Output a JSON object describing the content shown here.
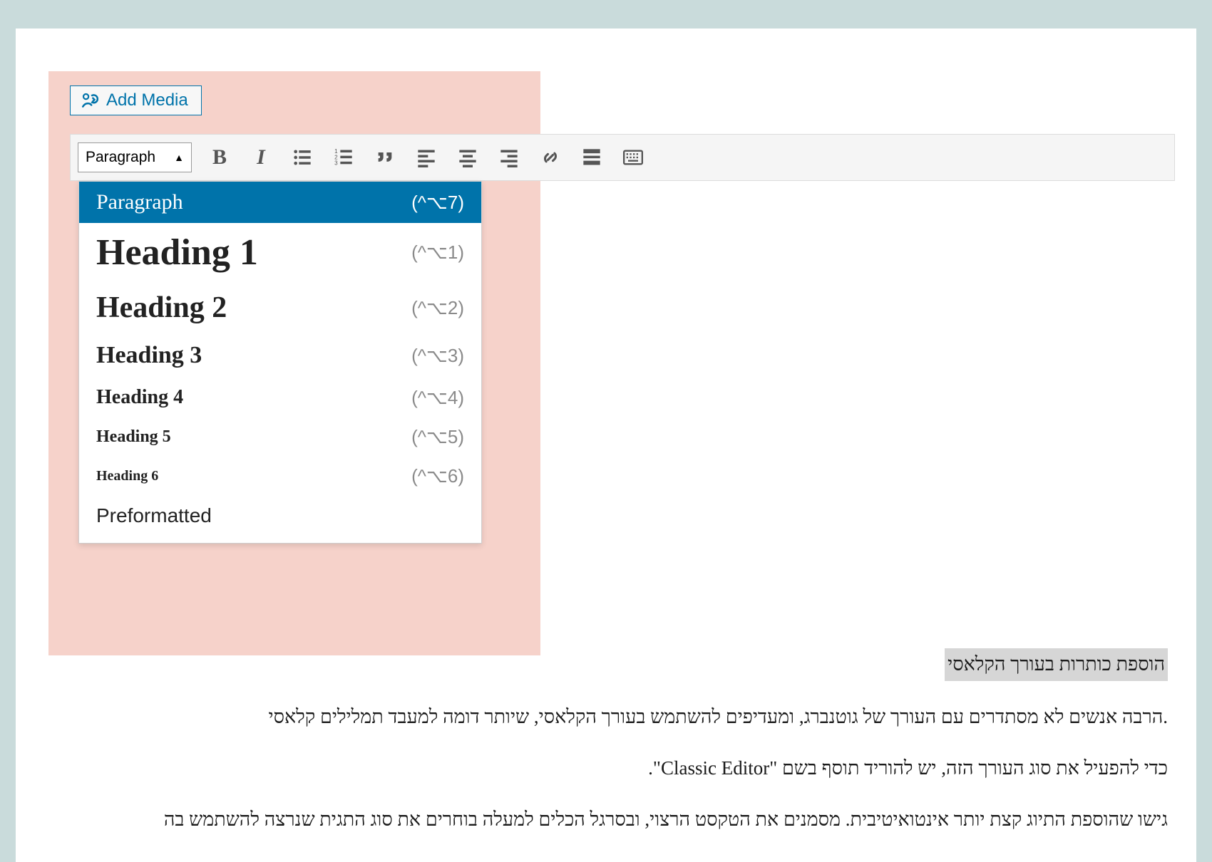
{
  "add_media_label": "Add Media",
  "toolbar": {
    "format_selected": "Paragraph",
    "bold_glyph": "B",
    "italic_glyph": "I"
  },
  "dropdown": {
    "items": [
      {
        "label": "Paragraph",
        "shortcut": "(^⌥7)",
        "cls": "selected"
      },
      {
        "label": "Heading 1",
        "shortcut": "(^⌥1)",
        "cls": "h1"
      },
      {
        "label": "Heading 2",
        "shortcut": "(^⌥2)",
        "cls": "h2"
      },
      {
        "label": "Heading 3",
        "shortcut": "(^⌥3)",
        "cls": "h3"
      },
      {
        "label": "Heading 4",
        "shortcut": "(^⌥4)",
        "cls": "h4"
      },
      {
        "label": "Heading 5",
        "shortcut": "(^⌥5)",
        "cls": "h5"
      },
      {
        "label": "Heading 6",
        "shortcut": "(^⌥6)",
        "cls": "h6"
      },
      {
        "label": "Preformatted",
        "shortcut": "",
        "cls": "pre"
      }
    ]
  },
  "content": {
    "caption": "הוספת כותרות בעורך הקלאסי",
    "p1": ".הרבה אנשים לא מסתדרים עם העורך של גוטנברג, ומעדיפים להשתמש בעורך הקלאסי, שיותר דומה למעבד תמלילים קלאסי",
    "p2": "כדי להפעיל את סוג העורך הזה, יש להוריד תוסף בשם \"Classic Editor\".",
    "p3": "גישו שהוספת התיוג קצת יותר אינטואיטיבית. מסמנים את הטקסט הרצוי, ובסרגל הכלים למעלה בוחרים את סוג התגית שנרצה להשתמש בה"
  }
}
